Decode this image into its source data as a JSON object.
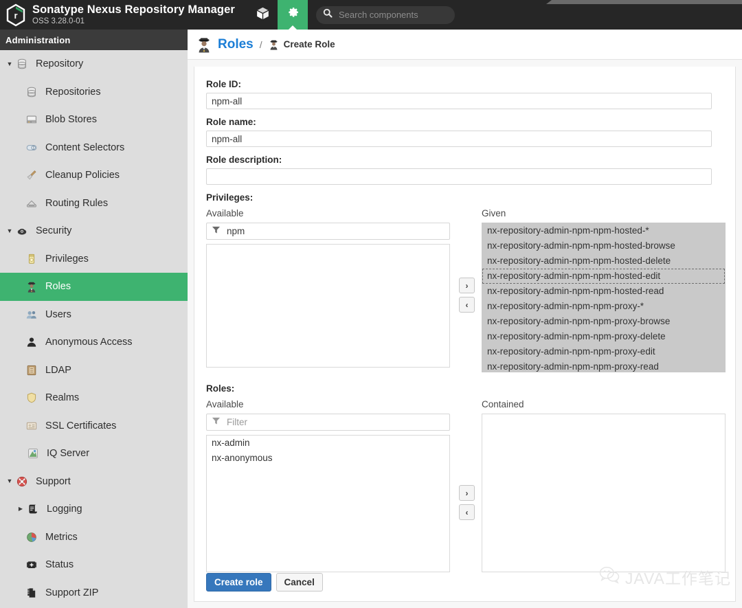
{
  "header": {
    "brand_title": "Sonatype Nexus Repository Manager",
    "brand_version": "OSS 3.28.0-01",
    "logo_icon": "nexus-hexagon-logo",
    "browse_tab_icon": "cube-icon",
    "admin_tab_icon": "gear-icon",
    "search": {
      "icon": "search-icon",
      "placeholder": "Search components",
      "value": ""
    }
  },
  "sidebar": {
    "title": "Administration",
    "items": [
      {
        "label": "Repository",
        "icon": "database-icon",
        "level": "group",
        "caret": "▼",
        "active": false
      },
      {
        "label": "Repositories",
        "icon": "database-icon",
        "level": "child",
        "caret": "",
        "active": false
      },
      {
        "label": "Blob Stores",
        "icon": "blobstore-icon",
        "level": "child",
        "caret": "",
        "active": false
      },
      {
        "label": "Content Selectors",
        "icon": "selector-icon",
        "level": "child",
        "caret": "",
        "active": false
      },
      {
        "label": "Cleanup Policies",
        "icon": "broom-icon",
        "level": "child",
        "caret": "",
        "active": false
      },
      {
        "label": "Routing Rules",
        "icon": "routing-icon",
        "level": "child",
        "caret": "",
        "active": false
      },
      {
        "label": "Security",
        "icon": "security-icon",
        "level": "group",
        "caret": "▼",
        "active": false
      },
      {
        "label": "Privileges",
        "icon": "medal-icon",
        "level": "child",
        "caret": "",
        "active": false
      },
      {
        "label": "Roles",
        "icon": "officer-icon",
        "level": "child",
        "caret": "",
        "active": true
      },
      {
        "label": "Users",
        "icon": "users-icon",
        "level": "child",
        "caret": "",
        "active": false
      },
      {
        "label": "Anonymous Access",
        "icon": "person-icon",
        "level": "child",
        "caret": "",
        "active": false
      },
      {
        "label": "LDAP",
        "icon": "book-icon",
        "level": "child",
        "caret": "",
        "active": false
      },
      {
        "label": "Realms",
        "icon": "shield-icon",
        "level": "child",
        "caret": "",
        "active": false
      },
      {
        "label": "SSL Certificates",
        "icon": "certificate-icon",
        "level": "child",
        "caret": "",
        "active": false
      },
      {
        "label": "IQ Server",
        "icon": "iq-icon",
        "level": "subchild",
        "caret": "",
        "active": false
      },
      {
        "label": "Support",
        "icon": "lifering-icon",
        "level": "group",
        "caret": "▼",
        "active": false
      },
      {
        "label": "Logging",
        "icon": "logging-icon",
        "level": "subchild",
        "caret": "▶",
        "active": false
      },
      {
        "label": "Metrics",
        "icon": "piechart-icon",
        "level": "child",
        "caret": "",
        "active": false
      },
      {
        "label": "Status",
        "icon": "firstaid-icon",
        "level": "child",
        "caret": "",
        "active": false
      },
      {
        "label": "Support ZIP",
        "icon": "zipfile-icon",
        "level": "child",
        "caret": "",
        "active": false
      }
    ]
  },
  "breadcrumb": {
    "root_label": "Roles",
    "root_icon": "officer-icon",
    "separator": "/",
    "current_label": "Create Role",
    "current_icon": "officer-small-icon"
  },
  "form": {
    "role_id": {
      "label": "Role ID:",
      "value": "npm-all",
      "placeholder": ""
    },
    "role_name": {
      "label": "Role name:",
      "value": "npm-all",
      "placeholder": ""
    },
    "role_description": {
      "label": "Role description:",
      "value": "",
      "placeholder": ""
    },
    "privileges": {
      "label": "Privileges:",
      "available_header": "Available",
      "given_header": "Given",
      "filter": {
        "icon": "filter-icon",
        "value": "npm",
        "placeholder": "Filter"
      },
      "available_items": [],
      "given_items": [
        {
          "label": "nx-repository-admin-npm-npm-hosted-*",
          "focused": false
        },
        {
          "label": "nx-repository-admin-npm-npm-hosted-browse",
          "focused": false
        },
        {
          "label": "nx-repository-admin-npm-npm-hosted-delete",
          "focused": false
        },
        {
          "label": "nx-repository-admin-npm-npm-hosted-edit",
          "focused": true
        },
        {
          "label": "nx-repository-admin-npm-npm-hosted-read",
          "focused": false
        },
        {
          "label": "nx-repository-admin-npm-npm-proxy-*",
          "focused": false
        },
        {
          "label": "nx-repository-admin-npm-npm-proxy-browse",
          "focused": false
        },
        {
          "label": "nx-repository-admin-npm-npm-proxy-delete",
          "focused": false
        },
        {
          "label": "nx-repository-admin-npm-npm-proxy-edit",
          "focused": false
        },
        {
          "label": "nx-repository-admin-npm-npm-proxy-read",
          "focused": false
        }
      ],
      "move_right_label": "›",
      "move_left_label": "‹"
    },
    "roles": {
      "label": "Roles:",
      "available_header": "Available",
      "contained_header": "Contained",
      "filter": {
        "icon": "filter-icon",
        "value": "",
        "placeholder": "Filter"
      },
      "available_items": [
        {
          "label": "nx-admin"
        },
        {
          "label": "nx-anonymous"
        }
      ],
      "contained_items": [],
      "move_right_label": "›",
      "move_left_label": "‹"
    },
    "submit_label": "Create role",
    "cancel_label": "Cancel"
  },
  "watermark": {
    "icon": "wechat-icon",
    "text": "JAVA工作笔记"
  },
  "colors": {
    "accent_green": "#3eb370",
    "link_blue": "#1c7ed6",
    "primary_button": "#3677bc",
    "topbar": "#262626",
    "sidebar": "#dddddd",
    "list_filled": "#c9c9c9"
  }
}
